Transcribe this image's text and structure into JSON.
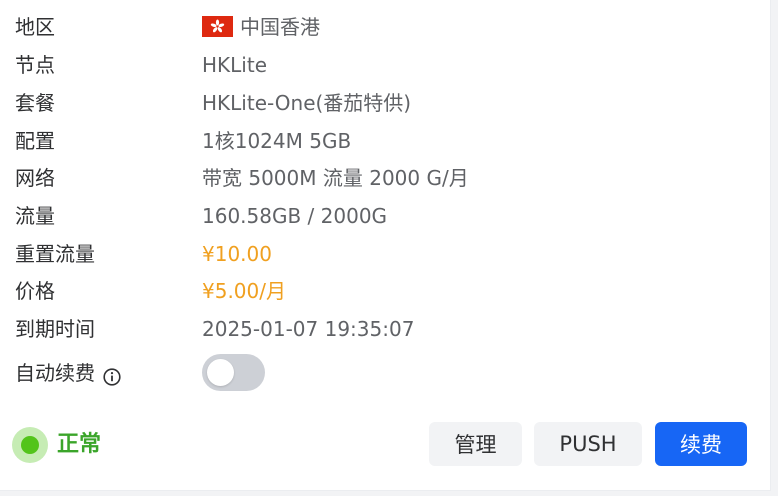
{
  "details": {
    "region_label": "地区",
    "region_value": "中国香港",
    "node_label": "节点",
    "node_value": "HKLite",
    "plan_label": "套餐",
    "plan_value": "HKLite-One(番茄特供)",
    "config_label": "配置",
    "config_value": "1核1024M 5GB",
    "network_label": "网络",
    "network_value": "带宽 5000M 流量 2000 G/月",
    "traffic_label": "流量",
    "traffic_value": "160.58GB / 2000G",
    "reset_label": "重置流量",
    "reset_value": "¥10.00",
    "price_label": "价格",
    "price_value": "¥5.00/月",
    "expire_label": "到期时间",
    "expire_value": "2025-01-07 19:35:07",
    "auto_renew_label": "自动续费",
    "auto_renew_on": false
  },
  "status": {
    "text": "正常",
    "color": "#52c41a"
  },
  "actions": {
    "manage_label": "管理",
    "push_label": "PUSH",
    "renew_label": "续费"
  },
  "colors": {
    "accent": "#f0a020",
    "primary": "#1766f5",
    "flag_red": "#de2910"
  },
  "icons": {
    "region_flag": "hong-kong-flag",
    "auto_renew_info": "info-icon"
  }
}
